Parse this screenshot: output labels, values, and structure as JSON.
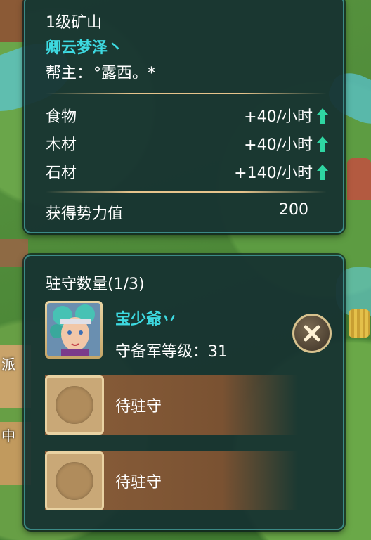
{
  "mine": {
    "level_title": "1级矿山",
    "alliance_name": "卿云梦泽丶",
    "leader_label": "帮主：",
    "leader_name": "°露西。*"
  },
  "resources": [
    {
      "name": "食物",
      "rate": "+40/小时",
      "icon": "up-arrow-icon"
    },
    {
      "name": "木材",
      "rate": "+40/小时",
      "icon": "up-arrow-icon"
    },
    {
      "name": "石材",
      "rate": "+140/小时",
      "icon": "up-arrow-icon"
    }
  ],
  "power": {
    "label": "获得势力值",
    "value": "200"
  },
  "garrison": {
    "title": "驻守数量(1/3)",
    "hero": {
      "name": "宝少爺丷",
      "level_label": "守备军等级：",
      "level_value": "31"
    },
    "empty_slots": [
      {
        "label": "待驻守"
      },
      {
        "label": "待驻守"
      }
    ]
  },
  "side_labels": {
    "dispatch": "派",
    "middle": "中"
  },
  "colors": {
    "accent_cyan": "#3dd9e0",
    "arrow_green": "#2fd6a2",
    "panel_bg": "#163030",
    "gold": "#e6c48c"
  }
}
